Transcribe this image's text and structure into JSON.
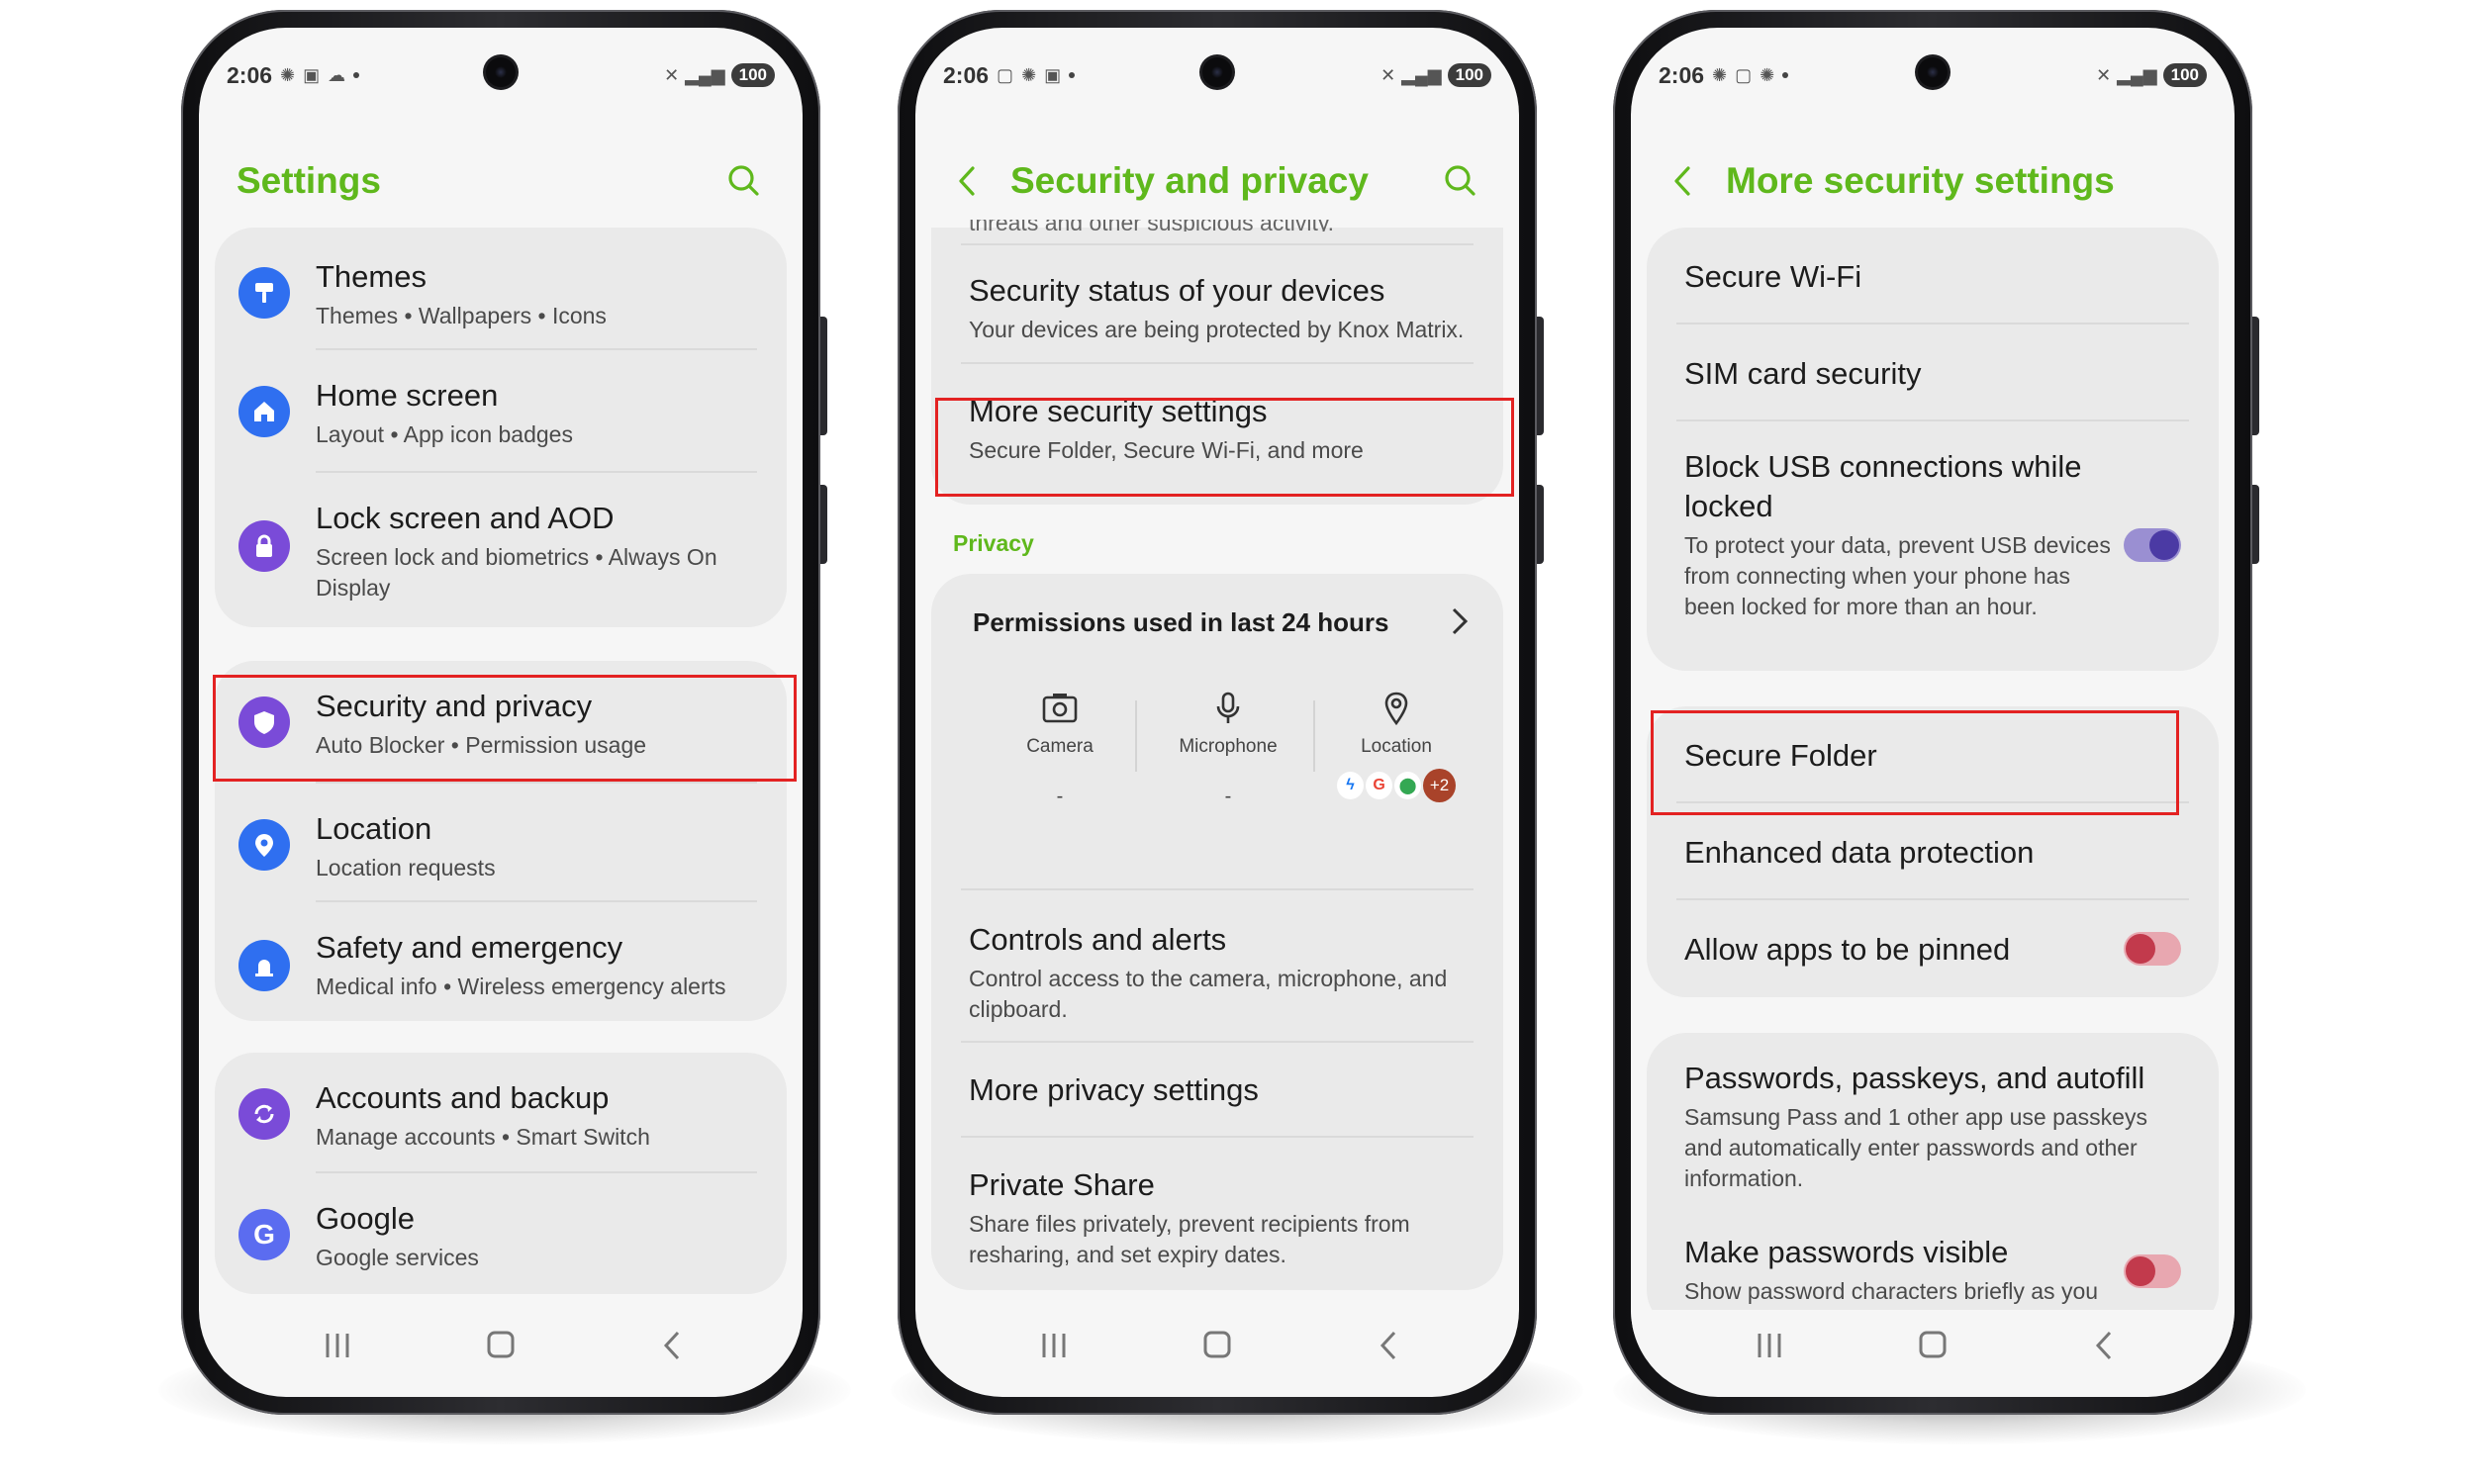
{
  "phone1": {
    "status": {
      "time": "2:06",
      "battery": "100"
    },
    "title": "Settings",
    "items": [
      {
        "title": "Themes",
        "subtitle": "Themes  •  Wallpapers  •  Icons"
      },
      {
        "title": "Home screen",
        "subtitle": "Layout  •  App icon badges"
      },
      {
        "title": "Lock screen and AOD",
        "subtitle": "Screen lock and biometrics  •  Always On Display"
      },
      {
        "title": "Security and privacy",
        "subtitle": "Auto Blocker  •  Permission usage"
      },
      {
        "title": "Location",
        "subtitle": "Location requests"
      },
      {
        "title": "Safety and emergency",
        "subtitle": "Medical info  •  Wireless emergency alerts"
      },
      {
        "title": "Accounts and backup",
        "subtitle": "Manage accounts  •  Smart Switch"
      },
      {
        "title": "Google",
        "subtitle": "Google services"
      }
    ]
  },
  "phone2": {
    "status": {
      "time": "2:06",
      "battery": "100"
    },
    "title": "Security and privacy",
    "cut_text": "threats and other suspicious activity.",
    "items": [
      {
        "title": "Security status of your devices",
        "subtitle": "Your devices are being protected by Knox Matrix."
      },
      {
        "title": "More security settings",
        "subtitle": "Secure Folder, Secure Wi-Fi, and more"
      }
    ],
    "privacy_label": "Privacy",
    "permissions_title": "Permissions used in last 24 hours",
    "permissions": [
      {
        "label": "Camera",
        "value": "-"
      },
      {
        "label": "Microphone",
        "value": "-"
      },
      {
        "label": "Location",
        "value": "+2"
      }
    ],
    "items2": [
      {
        "title": "Controls and alerts",
        "subtitle": "Control access to the camera, microphone, and clipboard."
      },
      {
        "title": "More privacy settings",
        "subtitle": ""
      },
      {
        "title": "Private Share",
        "subtitle": "Share files privately, prevent recipients from resharing, and set expiry dates."
      }
    ]
  },
  "phone3": {
    "status": {
      "time": "2:06",
      "battery": "100"
    },
    "title": "More security settings",
    "items": [
      {
        "title": "Secure Wi-Fi"
      },
      {
        "title": "SIM card security"
      },
      {
        "title": "Block USB connections while locked",
        "subtitle": "To protect your data, prevent USB devices from connecting when your phone has been locked for more than an hour.",
        "toggle": "on"
      },
      {
        "title": "Secure Folder"
      },
      {
        "title": "Enhanced data protection"
      },
      {
        "title": "Allow apps to be pinned",
        "toggle": "off"
      },
      {
        "title": "Passwords, passkeys, and autofill",
        "subtitle": "Samsung Pass and 1 other app use passkeys and automatically enter passwords and other information."
      },
      {
        "title": "Make passwords visible",
        "subtitle": "Show password characters briefly as you",
        "toggle": "off"
      }
    ]
  },
  "colors": {
    "accent_green": "#5fb81c",
    "highlight_red": "#e32222",
    "toggle_on": "#4b3aa4",
    "toggle_off": "#c23a4c"
  }
}
